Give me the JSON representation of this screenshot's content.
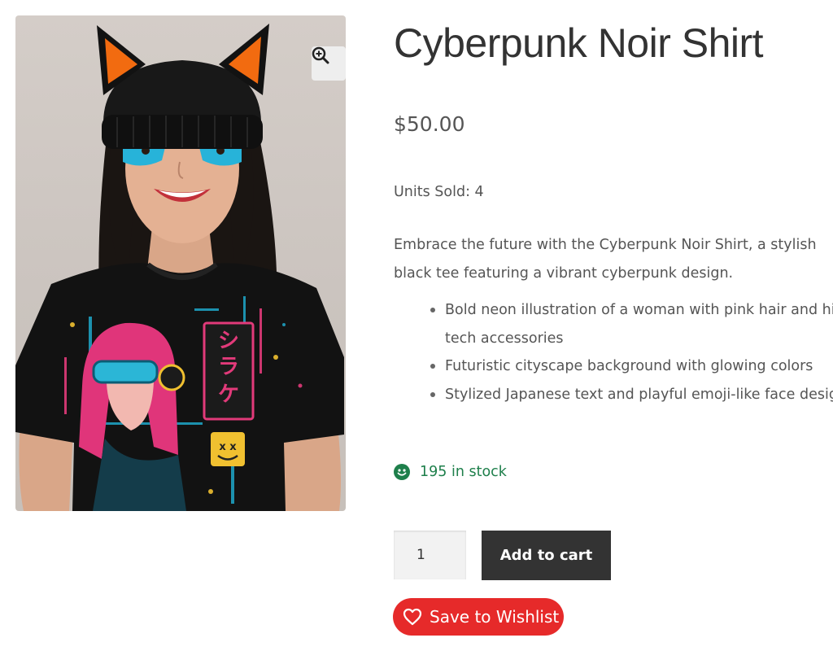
{
  "product": {
    "title": "Cyberpunk Noir Shirt",
    "price": "$50.00",
    "units_sold": "Units Sold: 4",
    "description": "Embrace the future with the Cyberpunk Noir Shirt, a stylish black tee featuring a vibrant cyberpunk design.",
    "features": [
      "Bold neon illustration of a woman with pink hair and high-tech accessories",
      "Futuristic cityscape background with glowing colors",
      "Stylized Japanese text and playful emoji-like face design"
    ],
    "stock": "195 in stock",
    "image_print_text": "シラケ"
  },
  "cart": {
    "quantity": "1",
    "add_label": "Add to cart",
    "wishlist_label": "Save to Wishlist"
  },
  "icons": {
    "zoom": "zoom-in-icon",
    "stock": "smiley-icon",
    "wishlist": "heart-icon"
  },
  "colors": {
    "stock_green": "#1e7f4b",
    "cart_button": "#333333",
    "wishlist_red": "#e62a2a",
    "title": "#333333",
    "body_text": "#555555"
  }
}
